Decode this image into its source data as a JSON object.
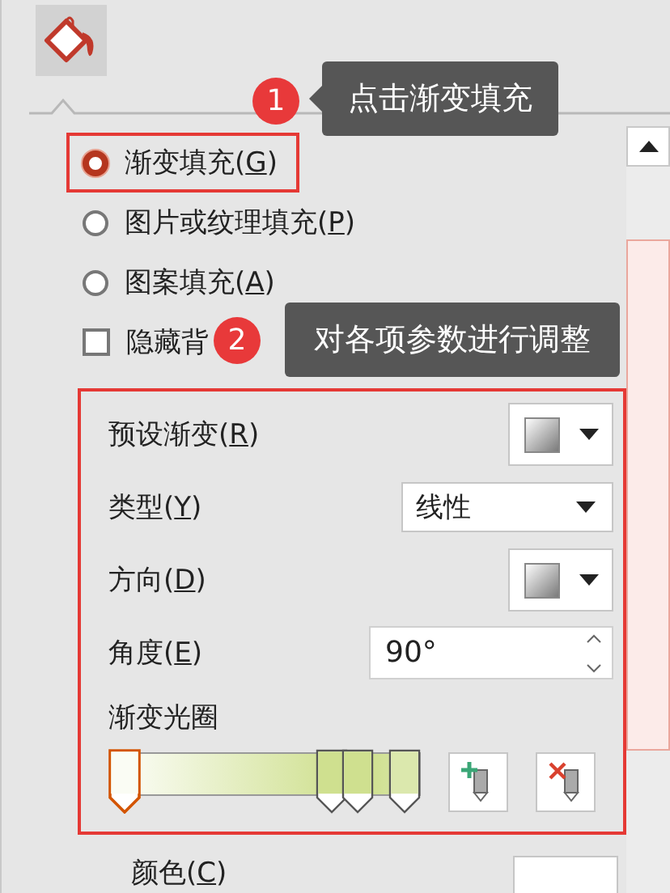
{
  "fill_tab": {
    "selected": true
  },
  "callouts": [
    {
      "number": "1",
      "text": "点击渐变填充"
    },
    {
      "number": "2",
      "text": "对各项参数进行调整"
    }
  ],
  "fill_options": [
    {
      "label": "渐变填充(G)",
      "selected": true,
      "highlighted": true
    },
    {
      "label": "图片或纹理填充(P)",
      "selected": false,
      "highlighted": false
    },
    {
      "label": "图案填充(A)",
      "selected": false,
      "highlighted": false
    }
  ],
  "hide_background": {
    "label": "隐藏背",
    "checked": false
  },
  "settings": {
    "highlighted": true,
    "preset": {
      "label": "预设渐变(R)"
    },
    "type": {
      "label": "类型(Y)",
      "value": "线性"
    },
    "direction": {
      "label": "方向(D)"
    },
    "angle": {
      "label": "角度(E)",
      "value": "90°"
    },
    "stops_label": "渐变光圈",
    "stops": [
      {
        "level": 0,
        "color": "#fafcf4",
        "selected": true
      },
      {
        "level": 0.74,
        "color": "#cfe08f",
        "selected": false
      },
      {
        "level": 0.83,
        "color": "#cfe08f",
        "selected": false
      },
      {
        "level": 1,
        "color": "#dbe8ad",
        "selected": false
      }
    ]
  },
  "color_row": {
    "label": "颜色(C)"
  }
}
